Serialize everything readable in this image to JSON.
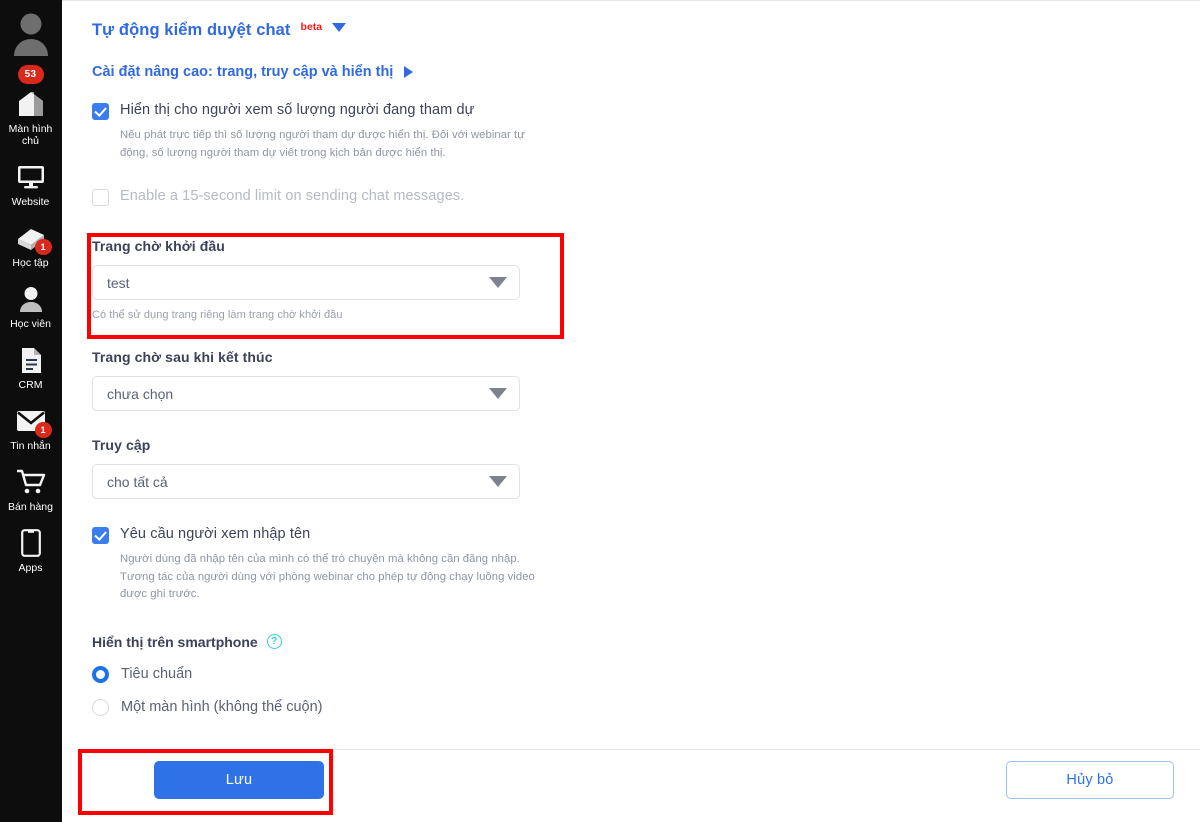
{
  "sidebar": {
    "avatar": {
      "icon": "user-avatar-icon",
      "badge": "53"
    },
    "items": [
      {
        "label": "Màn hình chủ",
        "icon": "home-icon",
        "badge": null
      },
      {
        "label": "Website",
        "icon": "monitor-icon",
        "badge": null
      },
      {
        "label": "Học tập",
        "icon": "book-icon",
        "badge": "1"
      },
      {
        "label": "Học viên",
        "icon": "student-icon",
        "badge": null
      },
      {
        "label": "CRM",
        "icon": "document-icon",
        "badge": null
      },
      {
        "label": "Tin nhắn",
        "icon": "envelope-icon",
        "badge": "1"
      },
      {
        "label": "Bán hàng",
        "icon": "cart-icon",
        "badge": null
      },
      {
        "label": "Apps",
        "icon": "phone-icon",
        "badge": null
      }
    ]
  },
  "main": {
    "title": "Tự động kiểm duyệt chat",
    "title_badge": "beta",
    "title_caret": "chevron-down-icon",
    "advanced_link": "Cài đặt nâng cao: trang, truy cập và hiển thị",
    "advanced_caret": "chevron-right-icon",
    "attendee_checkbox": {
      "label": "Hiển thị cho người xem số lượng người đang tham dự",
      "checked": true,
      "description": "Nếu phát trực tiếp thì số lượng người tham dự được hiển thị. Đối với webinar tự động, số lượng người tham dự viết trong kịch bản được hiển thị."
    },
    "chat_limit_checkbox": {
      "label": "Enable a 15-second limit on sending chat messages.",
      "checked": false
    },
    "start_waiting_page": {
      "label": "Trang chờ khởi đầu",
      "value": "test",
      "help": "Có thể sử dụng trang riêng làm trang chờ khởi đầu"
    },
    "end_waiting_page": {
      "label": "Trang chờ sau khi kết thúc",
      "value": "chưa chọn"
    },
    "access": {
      "label": "Truy cập",
      "value": "cho tất cả"
    },
    "require_name_checkbox": {
      "label": "Yêu cầu người xem nhập tên",
      "checked": true,
      "description": "Người dùng đã nhập tên của mình có thể trò chuyện mà không cần đăng nhập. Tương tác của người dùng với phòng webinar cho phép tự động chạy luồng video được ghi trước."
    },
    "smartphone": {
      "label": "Hiển thị trên smartphone",
      "help_icon": "help-circle-icon",
      "options": [
        {
          "label": "Tiêu chuẩn",
          "selected": true
        },
        {
          "label": "Một màn hình (không thể cuộn)",
          "selected": false
        }
      ]
    },
    "footer": {
      "save_label": "Lưu",
      "cancel_label": "Hủy bỏ"
    }
  },
  "colors": {
    "accent_blue": "#2f72e8",
    "link_blue": "#2f6ae1",
    "beta_red": "#ff1a1a",
    "badge_red": "#d9291c",
    "highlight_red": "#ff0000",
    "help_teal": "#35cfd4",
    "sidebar_bg": "#0d0d0d"
  }
}
